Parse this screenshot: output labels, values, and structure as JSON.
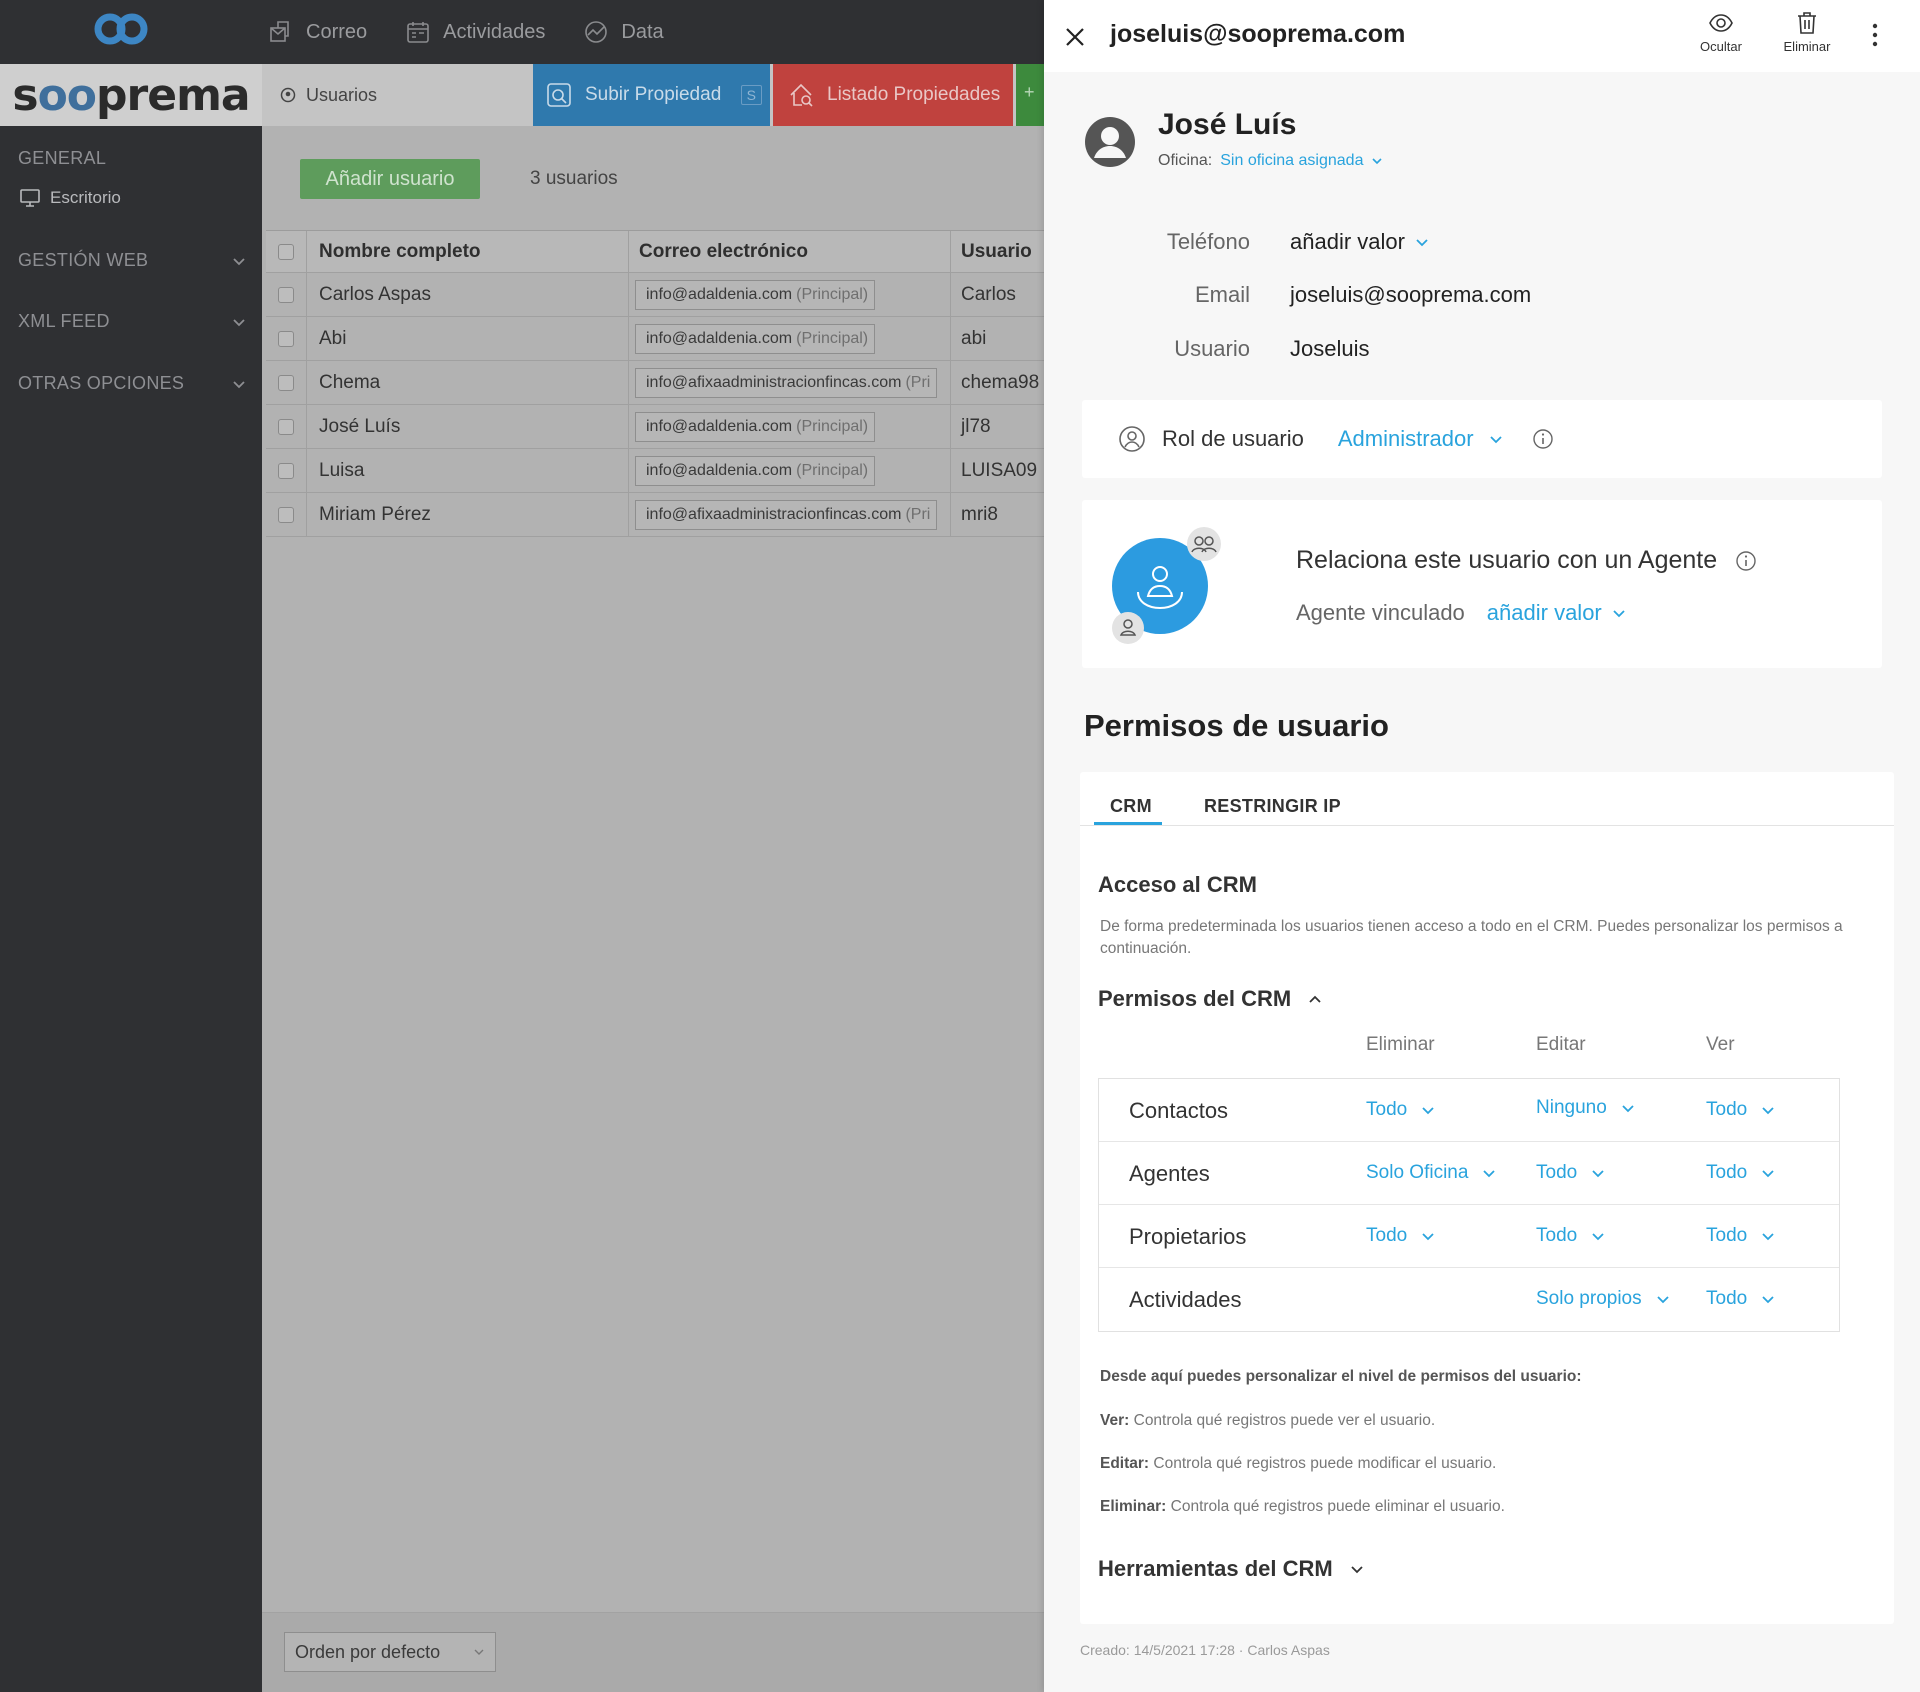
{
  "topnav": {
    "items": [
      {
        "label": "Correo",
        "icon": "mail-icon"
      },
      {
        "label": "Actividades",
        "icon": "calendar-icon"
      },
      {
        "label": "Data",
        "icon": "chart-icon"
      }
    ]
  },
  "brand": {
    "pre": "s",
    "oo": "oo",
    "post": "prema"
  },
  "subbar": {
    "users_label": "Usuarios",
    "subir_label": "Subir Propiedad",
    "subir_badge": "S",
    "listado_label": "Listado Propiedades",
    "green_label": "+"
  },
  "sidebar": {
    "general": "GENERAL",
    "escritorio": "Escritorio",
    "gestion_web": "GESTIÓN WEB",
    "xml_feed": "XML FEED",
    "otras": "OTRAS OPCIONES"
  },
  "main": {
    "add_button": "Añadir usuario",
    "count": "3 usuarios",
    "columns": {
      "name": "Nombre completo",
      "email": "Correo electrónico",
      "user": "Usuario"
    },
    "rows": [
      {
        "name": "Carlos Aspas",
        "email": "info@adaldenia.com",
        "tag": "(Principal)",
        "user": "Carlos"
      },
      {
        "name": "Abi",
        "email": "info@adaldenia.com",
        "tag": "(Principal)",
        "user": "abi"
      },
      {
        "name": "Chema",
        "email": "info@afixaadministracionfincas.com",
        "tag": "(Pri",
        "user": "chema98"
      },
      {
        "name": "José Luís",
        "email": "info@adaldenia.com",
        "tag": "(Principal)",
        "user": "jl78"
      },
      {
        "name": "Luisa",
        "email": "info@adaldenia.com",
        "tag": "(Principal)",
        "user": "LUISA09"
      },
      {
        "name": "Miriam Pérez",
        "email": "info@afixaadministracionfincas.com",
        "tag": "(Pri",
        "user": "mri8"
      }
    ],
    "order_select": "Orden por defecto"
  },
  "panel": {
    "title": "joseluis@sooprema.com",
    "actions": {
      "hide": "Ocultar",
      "delete": "Eliminar"
    },
    "name": "José Luís",
    "office_label": "Oficina:",
    "office_value": "Sin oficina asignada",
    "fields": {
      "phone_label": "Teléfono",
      "phone_value": "añadir valor",
      "email_label": "Email",
      "email_value": "joseluis@sooprema.com",
      "user_label": "Usuario",
      "user_value": "Joseluis"
    },
    "role": {
      "label": "Rol de usuario",
      "value": "Administrador"
    },
    "agent": {
      "title": "Relaciona este usuario con un Agente",
      "linked_label": "Agente vinculado",
      "linked_value": "añadir valor"
    },
    "permissions": {
      "heading": "Permisos de usuario",
      "tabs": {
        "crm": "CRM",
        "ip": "RESTRINGIR IP"
      },
      "access_title": "Acceso al CRM",
      "access_desc": "De forma predeterminada los usuarios tienen acceso a todo en el CRM. Puedes personalizar los permisos a continuación.",
      "crm_perms_title": "Permisos del CRM",
      "columns": {
        "delete": "Eliminar",
        "edit": "Editar",
        "view": "Ver"
      },
      "rows": [
        {
          "label": "Contactos",
          "delete": "Todo",
          "edit": "Ninguno",
          "view": "Todo"
        },
        {
          "label": "Agentes",
          "delete": "Solo Oficina",
          "edit": "Todo",
          "view": "Todo"
        },
        {
          "label": "Propietarios",
          "delete": "Todo",
          "edit": "Todo",
          "view": "Todo"
        },
        {
          "label": "Actividades",
          "delete": "",
          "edit": "Solo propios",
          "view": "Todo"
        }
      ],
      "notes": {
        "intro": "Desde aquí puedes personalizar el nivel de permisos del usuario:",
        "ver_label": "Ver:",
        "ver_text": " Controla qué registros puede ver el usuario.",
        "editar_label": "Editar:",
        "editar_text": " Controla qué registros puede modificar el usuario.",
        "eliminar_label": "Eliminar:",
        "eliminar_text": " Controla qué registros puede eliminar el usuario."
      },
      "tools_title": "Herramientas del CRM"
    },
    "created": "Creado: 14/5/2021 17:28 · Carlos Aspas"
  }
}
